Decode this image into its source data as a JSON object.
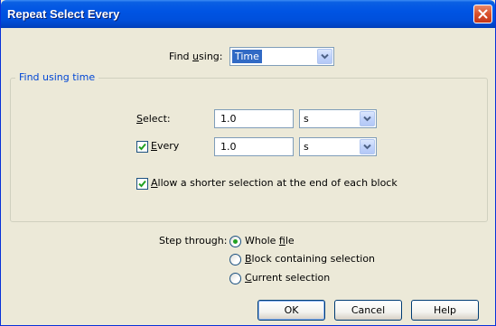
{
  "window": {
    "title": "Repeat Select Every"
  },
  "find_using": {
    "label_pre": "Find ",
    "label_u": "u",
    "label_post": "sing:",
    "value": "Time"
  },
  "group": {
    "legend": "Find using time",
    "select": {
      "label_u": "S",
      "label_post": "elect:",
      "value": "1.0",
      "unit": "s"
    },
    "every": {
      "checked": true,
      "label_u": "E",
      "label_post": "very",
      "value": "1.0",
      "unit": "s"
    },
    "allow_shorter": {
      "checked": true,
      "label_u": "A",
      "label_post": "llow a shorter selection at the end of each block"
    }
  },
  "step_through": {
    "label": "Step through:",
    "options": [
      {
        "pre": "Whole ",
        "u": "f",
        "post": "ile",
        "selected": true
      },
      {
        "pre": "",
        "u": "B",
        "post": "lock containing selection",
        "selected": false
      },
      {
        "pre": "",
        "u": "C",
        "post": "urrent selection",
        "selected": false
      }
    ]
  },
  "buttons": {
    "ok": "OK",
    "cancel": "Cancel",
    "help": "Help"
  },
  "colors": {
    "title_bar": "#0054E3",
    "dialog_bg": "#ECE9D8",
    "legend_text": "#0046D5",
    "selection_bg": "#316AC5",
    "radio_dot": "#21A121",
    "close_button": "#D9512A"
  },
  "icons": {
    "close": "close-x-icon",
    "dropdown": "chevron-down-icon",
    "check": "check-mark-icon"
  }
}
